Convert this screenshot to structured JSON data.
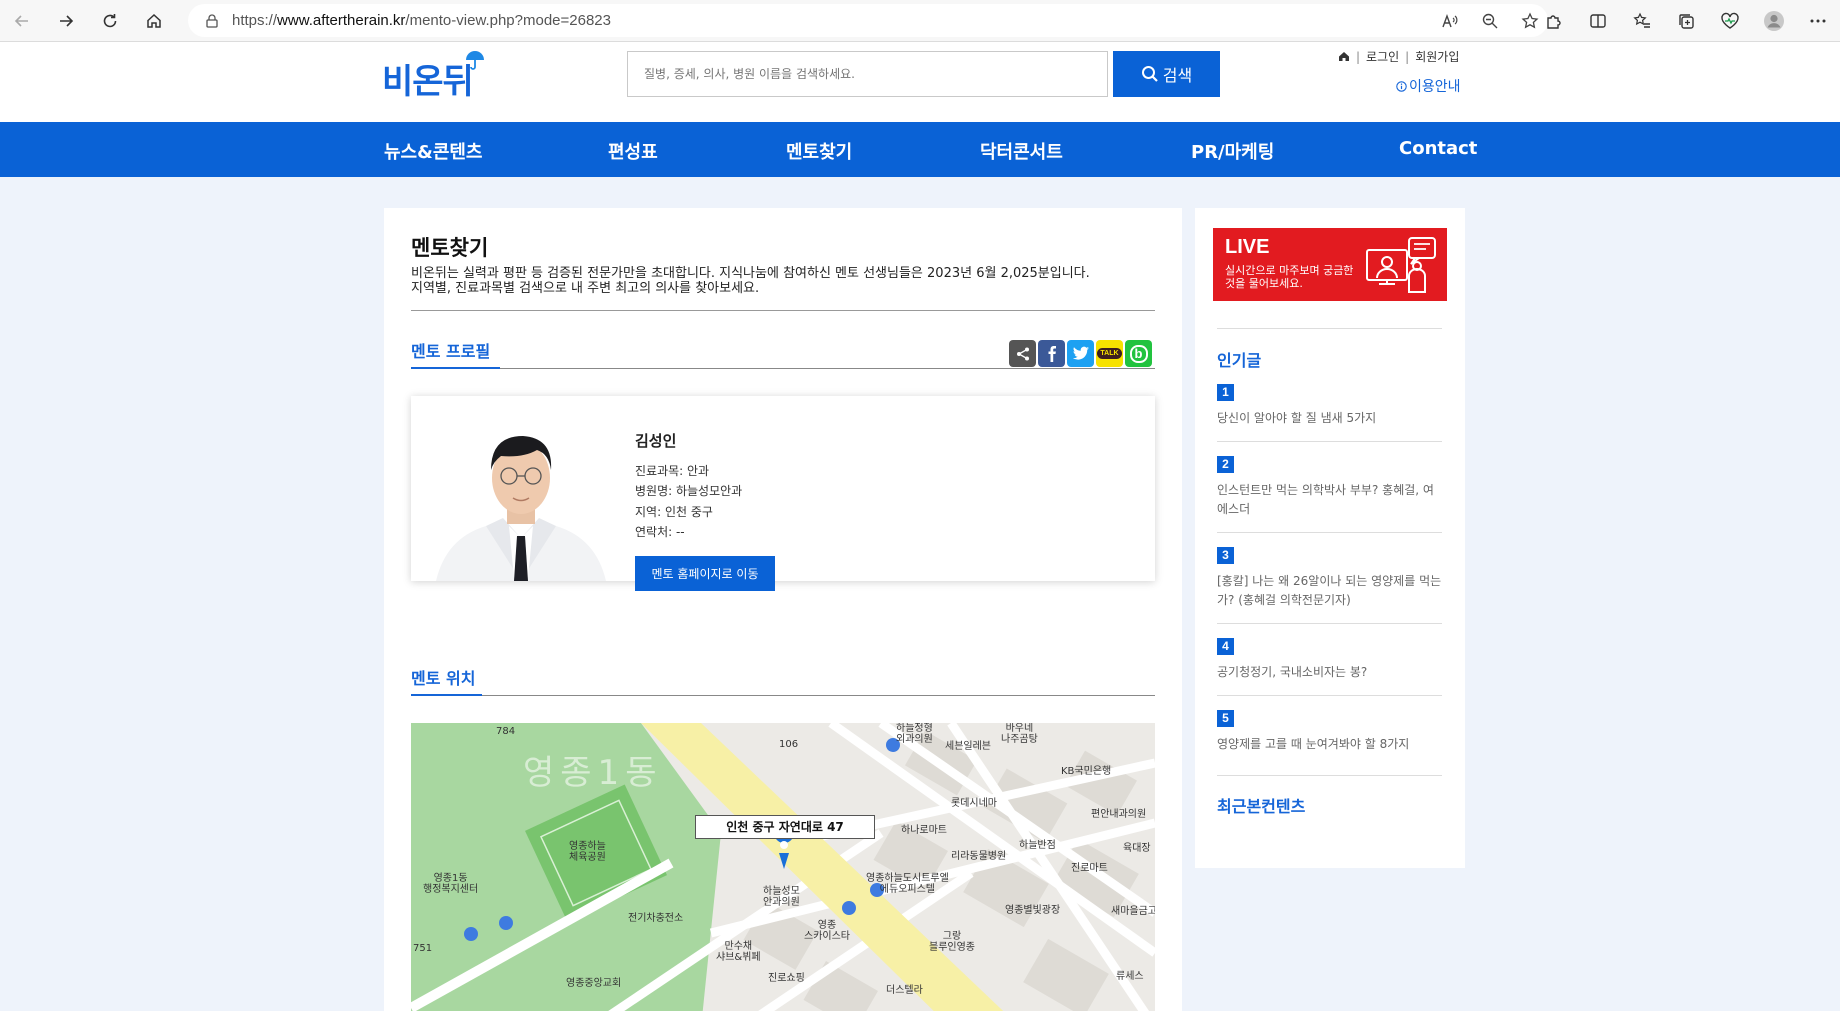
{
  "browser": {
    "url_prefix": "https://",
    "url_host": "www.aftertherain.kr",
    "url_path": "/mento-view.php?mode=26823"
  },
  "header": {
    "logo": "비온뒤",
    "search_placeholder": "질병, 증세, 의사, 병원 이름을 검색하세요.",
    "search_button": "검색",
    "login": "로그인",
    "signup": "회원가입",
    "usage": "이용안내"
  },
  "nav": [
    "뉴스&콘텐츠",
    "편성표",
    "멘토찾기",
    "닥터콘서트",
    "PR/마케팅",
    "Contact"
  ],
  "main": {
    "title": "멘토찾기",
    "intro_line1": "비온뒤는 실력과 평판 등 검증된 전문가만을 초대합니다. 지식나눔에 참여하신 멘토 선생님들은 2023년 6월 2,025분입니다.",
    "intro_line2": "지역별, 진료과목별 검색으로 내 주변 최고의 의사를 찾아보세요.",
    "profile_section": "멘토 프로필",
    "location_section": "멘토 위치",
    "share_talk": "TALK",
    "share_band": "b"
  },
  "profile": {
    "name": "김성인",
    "department": "진료과목: 안과",
    "hospital": "병원명: 하늘성모안과",
    "region": "지역: 인천 중구",
    "contact": "연락처: --",
    "homepage_button": "멘토 홈페이지로 이동"
  },
  "map": {
    "address": "인천 중구 자연대로 47",
    "district": "영종1동",
    "labels": {
      "n784": "784",
      "n106": "106",
      "n751": "751",
      "park": "영종하늘\n체육공원",
      "center": "영종1동\n행정복지센터",
      "substation": "전기차충전소",
      "hospital": "하늘성모\n안과의원",
      "skystar": "영종\n스카이스타",
      "manchae": "만수채\n샤브&뷔페",
      "jinro": "진로쇼핑",
      "church": "영종중앙교회",
      "haneul_surgery": "하늘정형\n외과의원",
      "bauneh": "바우네\n나주곰탕",
      "seven": "세븐일레븐",
      "kb": "KB국민은행",
      "lotte": "롯데시네마",
      "hana": "하나로마트",
      "pyeonan": "편안내과의원",
      "haneul_panjeom": "하늘반점",
      "riradong": "리라동물병원",
      "yukdae": "육대장",
      "jinmart": "진로마트",
      "city": "영종하늘도시트루엘\n에듀오피스텔",
      "plaza": "영종별빛광장",
      "saemaul": "새마을금고",
      "blue": "그랑\n블루인영종",
      "ryuse": "류세스",
      "deseutelra": "더스텔라"
    }
  },
  "sidebar": {
    "live_title": "LIVE",
    "live_sub": "실시간으로 마주보며 궁금한 것을 물어보세요.",
    "popular_title": "인기글",
    "popular": [
      {
        "rank": "1",
        "text": "당신이 알아야 할 질 냄새 5가지"
      },
      {
        "rank": "2",
        "text": "인스턴트만 먹는 의학박사 부부? 홍혜걸, 여에스더"
      },
      {
        "rank": "3",
        "text": "[홍칼] 나는 왜 26알이나 되는 영양제를 먹는가? (홍혜걸 의학전문기자)"
      },
      {
        "rank": "4",
        "text": "공기청정기, 국내소비자는 봉?"
      },
      {
        "rank": "5",
        "text": "영양제를 고를 때 눈여겨봐야 할 8가지"
      }
    ],
    "recent_title": "최근본컨텐츠"
  },
  "colors": {
    "brand": "#0a62d6",
    "live": "#e21b20",
    "park": "#a7d6a0",
    "road": "#f8f0a8"
  }
}
